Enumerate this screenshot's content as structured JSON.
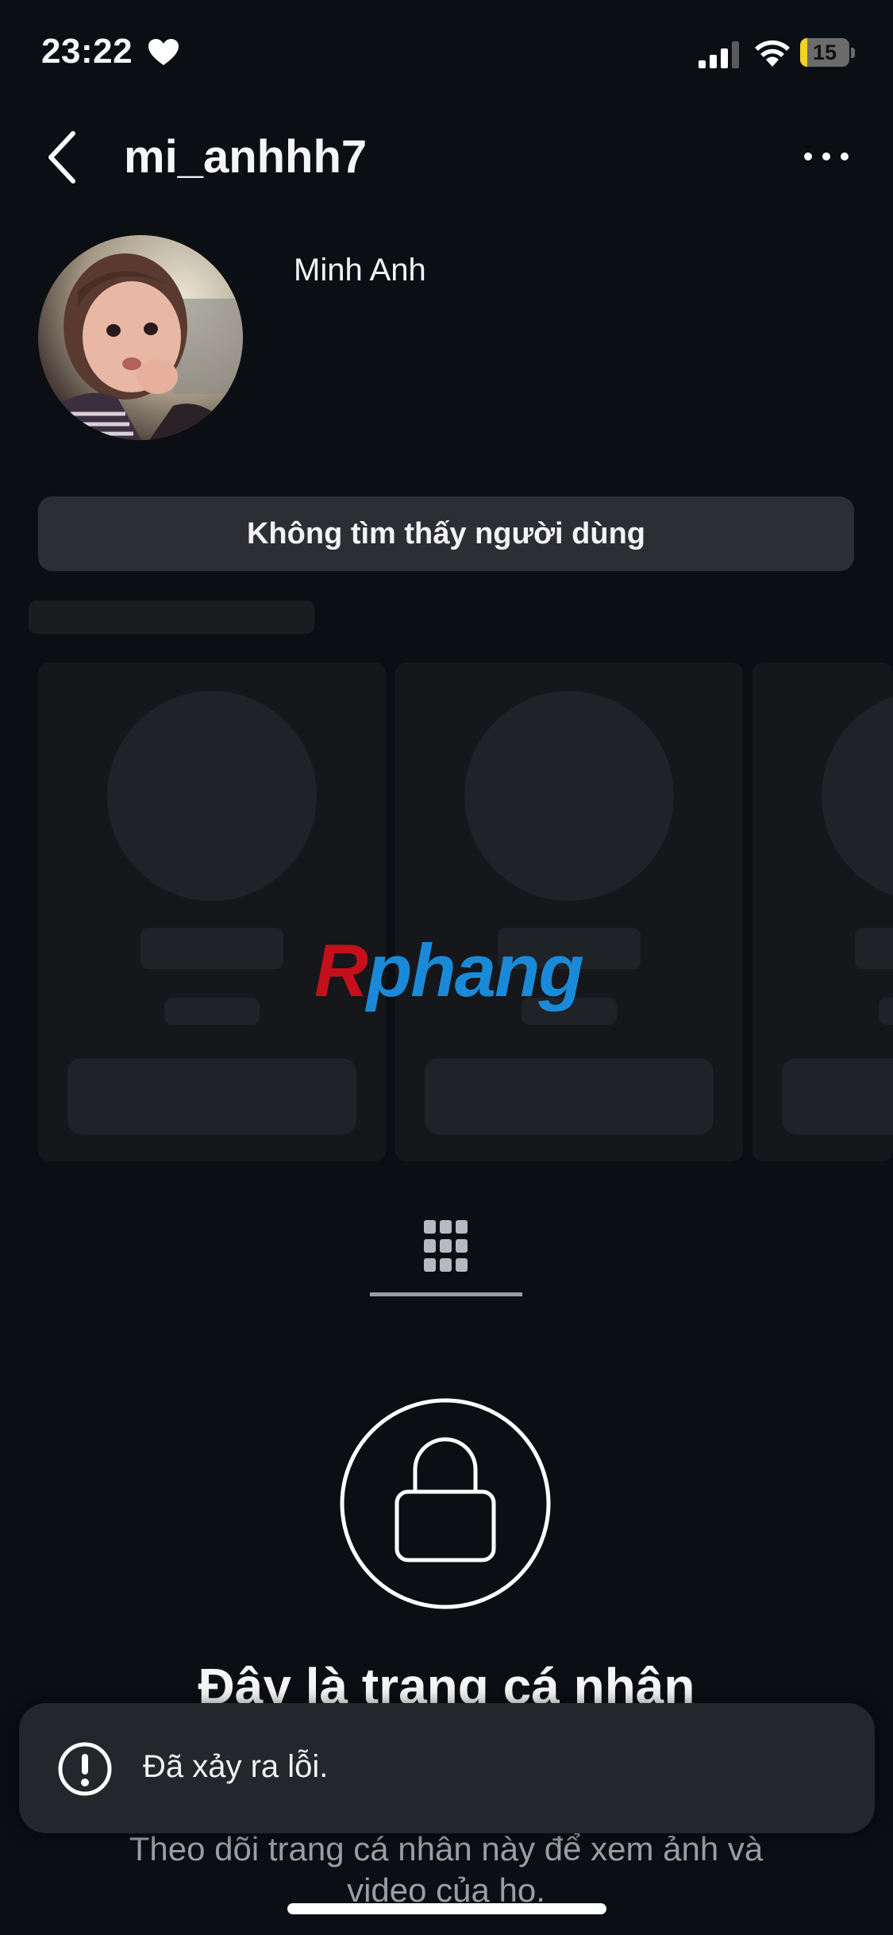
{
  "status_bar": {
    "time": "23:22",
    "battery_level": "15",
    "icons": [
      "heart-icon",
      "signal-icon",
      "wifi-icon",
      "battery-icon"
    ],
    "battery_color": "#f3d31f"
  },
  "header": {
    "username": "mi_anhhh7",
    "icons": [
      "back-chevron-icon",
      "more-options-icon"
    ]
  },
  "profile": {
    "display_name": "Minh Anh",
    "not_found_label": "Không tìm thấy người dùng"
  },
  "watermark": {
    "first": "R",
    "rest": "phang"
  },
  "tabs": {
    "icons": [
      "grid-icon"
    ]
  },
  "private_section": {
    "title": "Đây là trang cá nhân",
    "subtitle": "Theo dõi trang cá nhân này để xem ảnh và video của họ.",
    "icons": [
      "lock-icon"
    ]
  },
  "toast": {
    "message": "Đã xảy ra lỗi.",
    "icons": [
      "alert-circle-icon"
    ]
  },
  "colors": {
    "background": "#0b0e12",
    "button": "#2c2e33",
    "toast": "#23262b"
  }
}
